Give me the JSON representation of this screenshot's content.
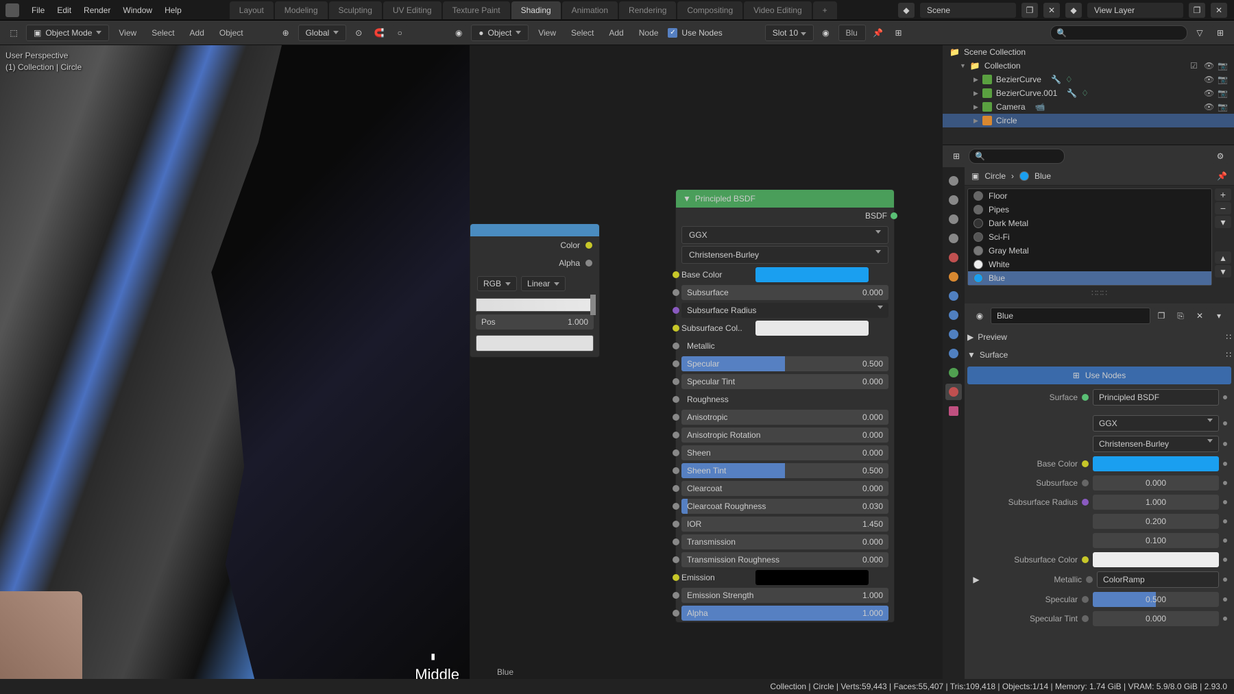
{
  "menus": {
    "file": "File",
    "edit": "Edit",
    "render": "Render",
    "window": "Window",
    "help": "Help"
  },
  "workspaces": {
    "layout": "Layout",
    "modeling": "Modeling",
    "sculpting": "Sculpting",
    "uv": "UV Editing",
    "texpaint": "Texture Paint",
    "shading": "Shading",
    "animation": "Animation",
    "rendering": "Rendering",
    "compositing": "Compositing",
    "videoediting": "Video Editing"
  },
  "topright": {
    "scene": "Scene",
    "viewlayer": "View Layer"
  },
  "toolbar3d": {
    "mode": "Object Mode",
    "view": "View",
    "select": "Select",
    "add": "Add",
    "object": "Object",
    "orient": "Global"
  },
  "toolbarnode": {
    "object": "Object",
    "view": "View",
    "select": "Select",
    "add": "Add",
    "node": "Node",
    "usenodes": "Use Nodes",
    "slot": "Slot 10",
    "mat": "Blu"
  },
  "viewport": {
    "line1": "User Perspective",
    "line2": "(1) Collection | Circle",
    "middle": "Middle",
    "matname": "Blue"
  },
  "colorramp": {
    "out_color": "Color",
    "out_alpha": "Alpha",
    "mode": "RGB",
    "interp": "Linear",
    "pos_label": "Pos",
    "pos_val": "1.000"
  },
  "bsdf": {
    "title": "Principled BSDF",
    "output": "BSDF",
    "distribution": "GGX",
    "sss_method": "Christensen-Burley",
    "base_color": "Base Color",
    "subsurface": "Subsurface",
    "subsurface_v": "0.000",
    "subsurface_radius": "Subsurface Radius",
    "subsurface_color": "Subsurface Col..",
    "metallic": "Metallic",
    "specular": "Specular",
    "specular_v": "0.500",
    "specular_tint": "Specular Tint",
    "specular_tint_v": "0.000",
    "roughness": "Roughness",
    "anisotropic": "Anisotropic",
    "anisotropic_v": "0.000",
    "anisotropic_rot": "Anisotropic Rotation",
    "anisotropic_rot_v": "0.000",
    "sheen": "Sheen",
    "sheen_v": "0.000",
    "sheen_tint": "Sheen Tint",
    "sheen_tint_v": "0.500",
    "clearcoat": "Clearcoat",
    "clearcoat_v": "0.000",
    "clearcoat_rough": "Clearcoat Roughness",
    "clearcoat_rough_v": "0.030",
    "ior": "IOR",
    "ior_v": "1.450",
    "transmission": "Transmission",
    "transmission_v": "0.000",
    "transmission_rough": "Transmission Roughness",
    "transmission_rough_v": "0.000",
    "emission": "Emission",
    "emission_strength": "Emission Strength",
    "emission_strength_v": "1.000",
    "alpha": "Alpha",
    "alpha_v": "1.000"
  },
  "outliner": {
    "scene_collection": "Scene Collection",
    "collection": "Collection",
    "items": [
      "BezierCurve",
      "BezierCurve.001",
      "Camera",
      "Circle"
    ]
  },
  "props": {
    "obj": "Circle",
    "mat": "Blue",
    "matname": "Blue",
    "slots": [
      "Floor",
      "Pipes",
      "Dark Metal",
      "Sci-Fi",
      "Gray Metal",
      "White",
      "Blue"
    ],
    "preview": "Preview",
    "surface": "Surface",
    "use_nodes": "Use Nodes",
    "surface_label": "Surface",
    "surface_val": "Principled BSDF",
    "distribution": "GGX",
    "sss_method": "Christensen-Burley",
    "base_color": "Base Color",
    "subsurface": "Subsurface",
    "subsurface_v": "0.000",
    "subsurface_radius": "Subsurface Radius",
    "ssr_v1": "1.000",
    "ssr_v2": "0.200",
    "ssr_v3": "0.100",
    "subsurface_color": "Subsurface Color",
    "metallic": "Metallic",
    "metallic_v": "ColorRamp",
    "specular": "Specular",
    "specular_v": "0.500",
    "specular_tint": "Specular Tint",
    "specular_tint_v": "0.000"
  },
  "status": "Collection | Circle | Verts:59,443 | Faces:55,407 | Tris:109,418 | Objects:1/14 | Memory: 1.74 GiB | VRAM: 5.9/8.0 GiB | 2.93.0"
}
